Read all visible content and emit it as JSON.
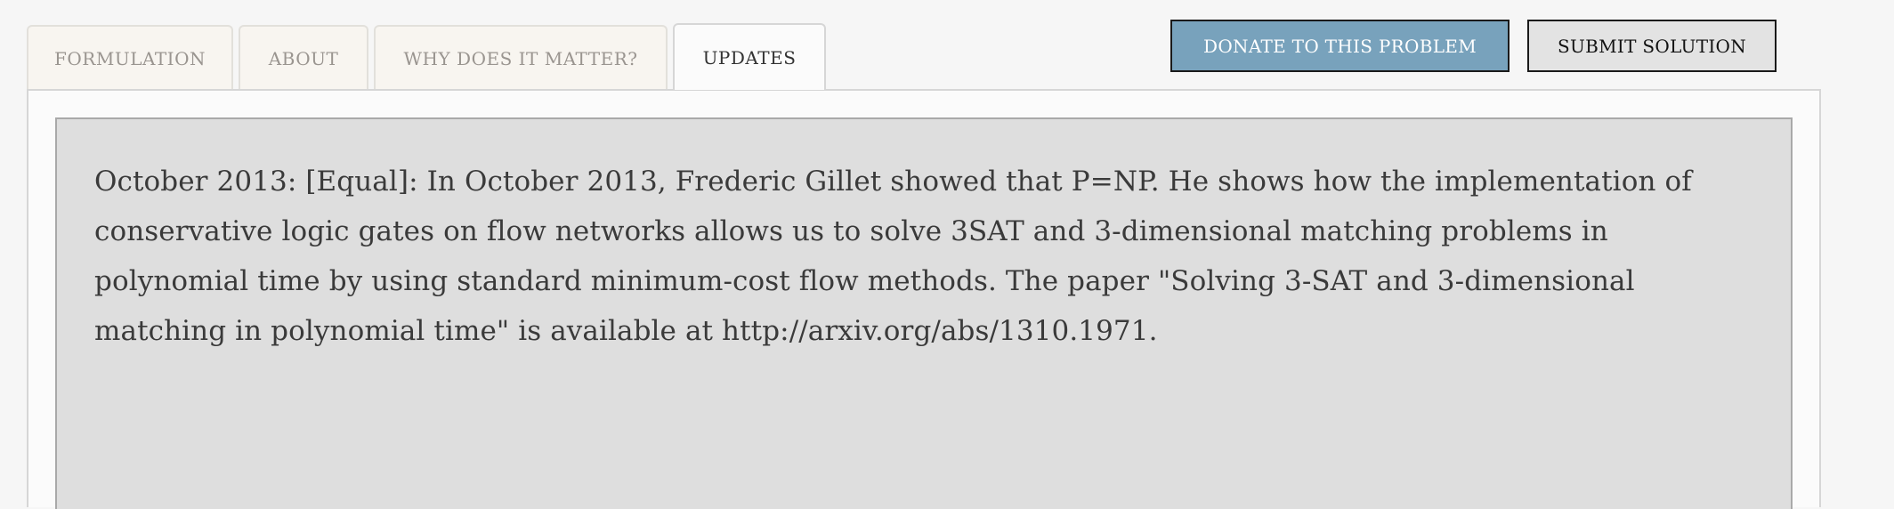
{
  "tabs": [
    {
      "label": "FORMULATION",
      "active": false
    },
    {
      "label": "ABOUT",
      "active": false
    },
    {
      "label": "WHY DOES IT MATTER?",
      "active": false
    },
    {
      "label": "UPDATES",
      "active": true
    }
  ],
  "actions": {
    "donate_label": "DONATE TO THIS PROBLEM",
    "submit_label": "SUBMIT SOLUTION"
  },
  "updates": {
    "entry_text": "October 2013: [Equal]: In October 2013, Frederic Gillet showed that P=NP. He shows how the implementation of conservative logic gates on flow networks allows us to solve 3SAT and 3-dimensional matching problems in polynomial time by using standard minimum-cost flow methods. The paper \"Solving 3-SAT and 3-dimensional matching in polynomial time\" is available at http://arxiv.org/abs/1310.1971."
  },
  "colors": {
    "donate_bg": "#78a2bc",
    "submit_bg": "#e3e3e3",
    "update_box_bg": "#dedede"
  }
}
